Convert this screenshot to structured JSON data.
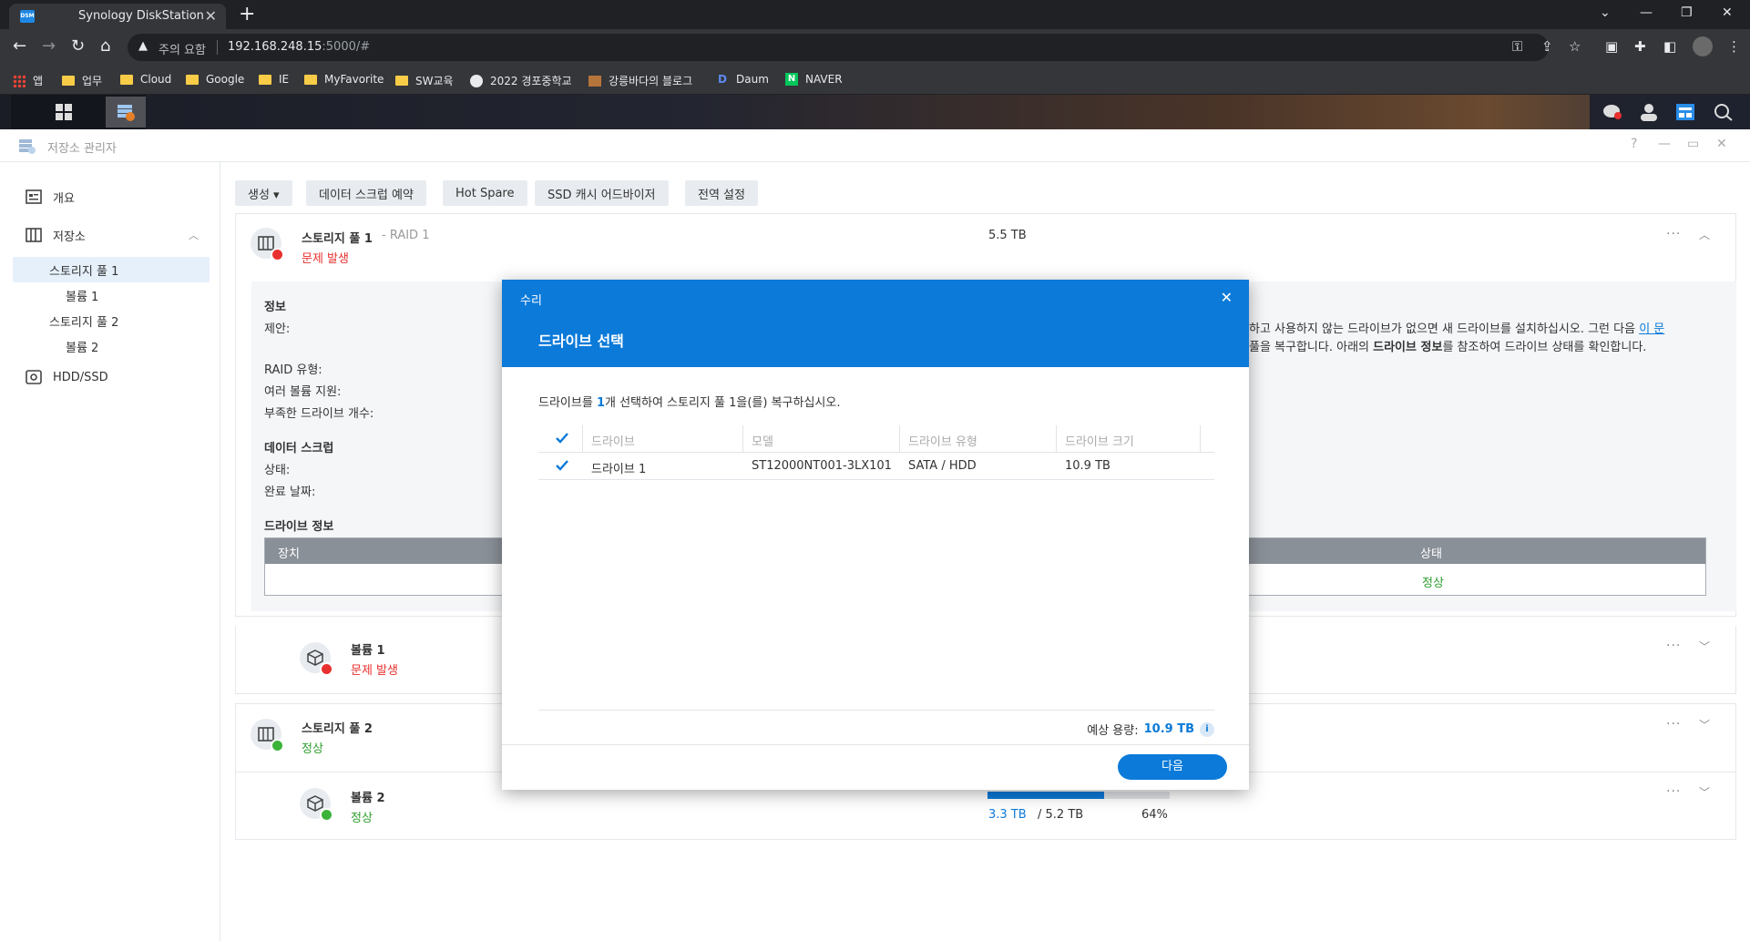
{
  "browser": {
    "tab_title": "Synology DiskStation",
    "tab_favicon": "DSM",
    "security_warning": "주의 요함",
    "url_host": "192.168.248.15",
    "url_path": ":5000/#",
    "bookmarks": [
      {
        "label": "앱",
        "icon": "apps-grid-icon"
      },
      {
        "label": "업무",
        "icon": "folder-icon"
      },
      {
        "label": "Cloud",
        "icon": "folder-icon"
      },
      {
        "label": "Google",
        "icon": "folder-icon"
      },
      {
        "label": "IE",
        "icon": "folder-icon"
      },
      {
        "label": "MyFavorite",
        "icon": "folder-icon"
      },
      {
        "label": "SW교육",
        "icon": "folder-icon"
      },
      {
        "label": "2022 경포중학교",
        "icon": "globe-icon"
      },
      {
        "label": "강릉바다의 블로그",
        "icon": "blog-icon"
      },
      {
        "label": "Daum",
        "icon": "daum-icon"
      },
      {
        "label": "NAVER",
        "icon": "naver-icon"
      }
    ]
  },
  "window": {
    "title": "저장소 관리자",
    "controls": [
      "?",
      "—",
      "▭",
      "✕"
    ]
  },
  "sidebar": {
    "items": [
      {
        "label": "개요"
      },
      {
        "label": "저장소"
      },
      {
        "label": "스토리지 풀 1"
      },
      {
        "label": "볼륨 1"
      },
      {
        "label": "스토리지 풀 2"
      },
      {
        "label": "볼륨 2"
      },
      {
        "label": "HDD/SSD"
      }
    ]
  },
  "toolbar": {
    "create": "생성 ▾",
    "scrub_schedule": "데이터 스크럽 예약",
    "hot_spare": "Hot Spare",
    "ssd_advisor": "SSD 캐시 어드바이저",
    "global_settings": "전역 설정"
  },
  "pool1": {
    "name": "스토리지 풀 1",
    "raid": "- RAID 1",
    "size": "5.5 TB",
    "status": "문제 발생",
    "info_heading": "정보",
    "suggestion_label": "제안:",
    "suggestion_line1": "하고 사용하지 않는 드라이브가 없으면 새 드라이브를 설치하십시오. 그런 다음 ",
    "suggestion_link": "이 문",
    "suggestion_line2_a": "풀을 복구합니다. 아래의 ",
    "suggestion_line2_b": "드라이브 정보",
    "suggestion_line2_c": "를 참조하여 드라이브 상태를 확인합니다.",
    "raid_type_label": "RAID 유형:",
    "multi_volume_label": "여러 볼륨 지원:",
    "missing_drives_label": "부족한 드라이브 개수:",
    "scrub_heading": "데이터 스크럽",
    "scrub_status_label": "상태:",
    "scrub_done_label": "완료 날짜:",
    "drive_info_heading": "드라이브 정보",
    "table_col_device": "장치",
    "table_col_status": "상태",
    "table_row_status": "정상"
  },
  "volume1": {
    "name": "볼륨 1",
    "status": "문제 발생"
  },
  "pool2": {
    "name": "스토리지 풀 2",
    "status": "정상"
  },
  "volume2": {
    "name": "볼륨 2",
    "status": "정상",
    "used": "3.3 TB",
    "total": "/ 5.2 TB",
    "percent": "64%",
    "usage_fraction": 0.64
  },
  "modal": {
    "window_title": "수리",
    "heading": "드라이브 선택",
    "desc_a": "드라이브를 ",
    "desc_num": "1",
    "desc_b": "개 선택하여 스토리지 풀 1을(를) 복구하십시오.",
    "columns": [
      "드라이브",
      "모델",
      "드라이브 유형",
      "드라이브 크기"
    ],
    "rows": [
      {
        "drive": "드라이브 1",
        "model": "ST12000NT001-3LX101",
        "type": "SATA / HDD",
        "size": "10.9 TB",
        "checked": true
      }
    ],
    "capacity_label": "예상 용량:",
    "capacity_value": "10.9 TB",
    "next_button": "다음"
  },
  "colors": {
    "accent": "#0b7ad9",
    "error": "#e8312f",
    "ok": "#2e9e2e"
  }
}
